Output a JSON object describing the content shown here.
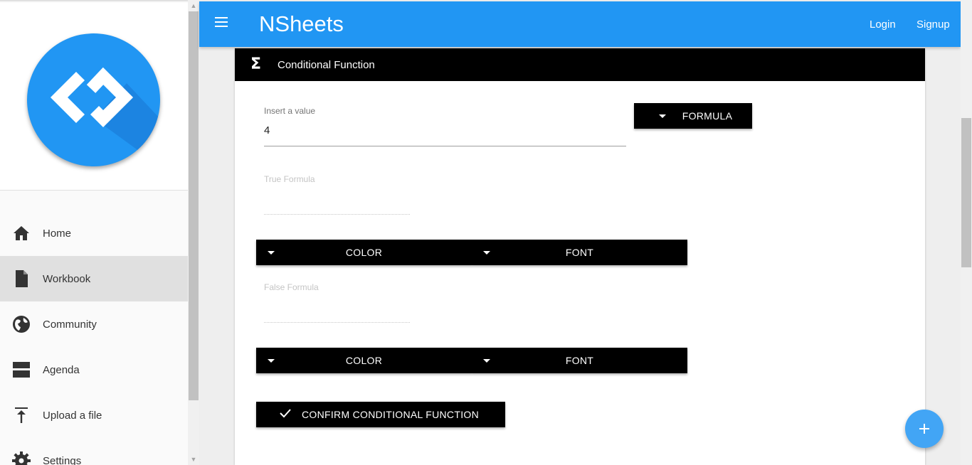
{
  "app": {
    "title": "NSheets"
  },
  "appbar": {
    "login": "Login",
    "signup": "Signup"
  },
  "sidebar": {
    "items": [
      {
        "label": "Home",
        "icon": "home-icon",
        "active": false
      },
      {
        "label": "Workbook",
        "icon": "file-icon",
        "active": true
      },
      {
        "label": "Community",
        "icon": "globe-icon",
        "active": false
      },
      {
        "label": "Agenda",
        "icon": "agenda-icon",
        "active": false
      },
      {
        "label": "Upload a file",
        "icon": "upload-icon",
        "active": false
      },
      {
        "label": "Settings",
        "icon": "gear-icon",
        "active": false
      }
    ]
  },
  "card": {
    "title": "Conditional Function",
    "value_field": {
      "label": "Insert a value",
      "value": "4"
    },
    "formula_button": "FORMULA",
    "true_formula": {
      "label": "True Formula",
      "value": ""
    },
    "false_formula": {
      "label": "False Formula",
      "value": ""
    },
    "true_buttons": {
      "color": "COLOR",
      "font": "FONT"
    },
    "false_buttons": {
      "color": "COLOR",
      "font": "FONT"
    },
    "confirm_button": "CONFIRM CONDITIONAL FUNCTION"
  },
  "colors": {
    "primary": "#2196f3",
    "accent": "#42a5f5",
    "header": "#000000"
  }
}
